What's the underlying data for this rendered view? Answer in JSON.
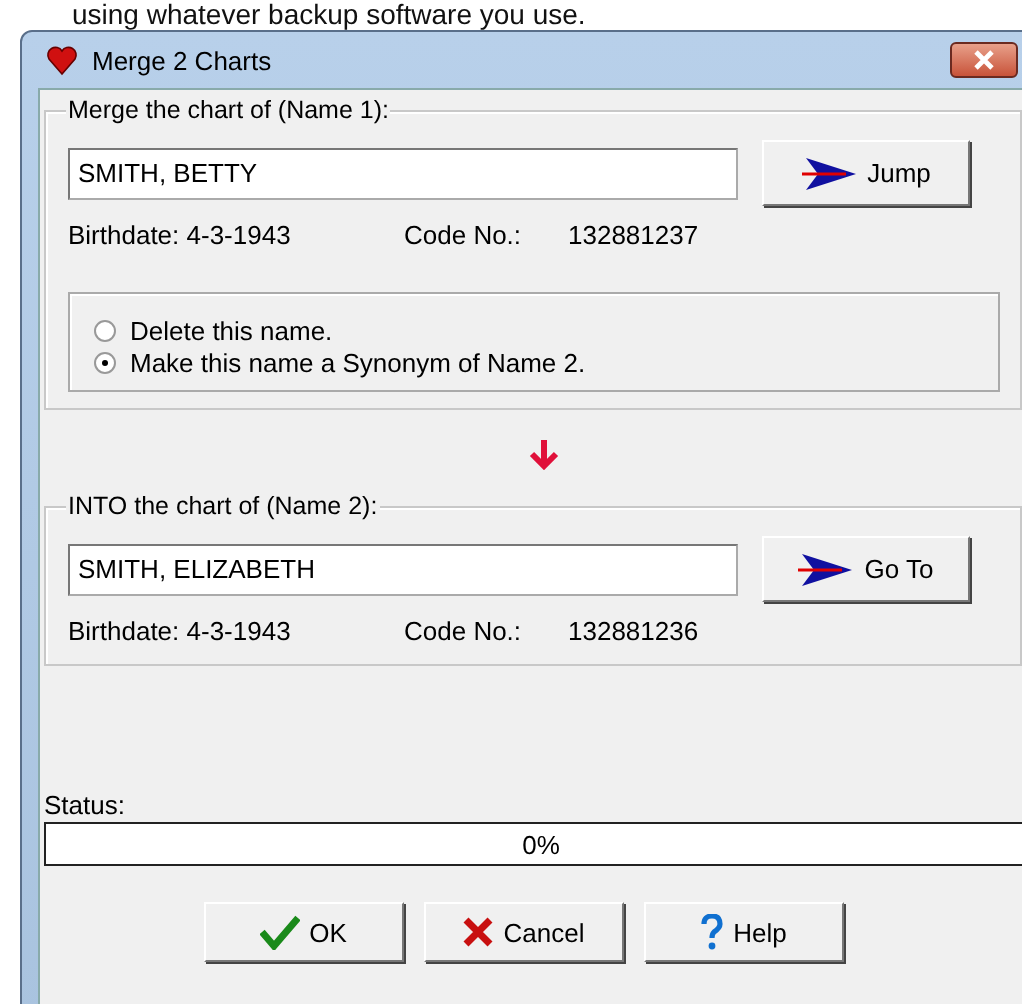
{
  "caption": "using whatever backup software you use.",
  "window": {
    "title": "Merge 2 Charts"
  },
  "groups": [
    {
      "legend": "Merge the chart of (Name 1):",
      "name": "SMITH, BETTY",
      "button": "Jump",
      "birthdate": "Birthdate: 4-3-1943",
      "code_label": "Code No.:",
      "code": "132881237",
      "options": [
        {
          "label": "Delete this name.",
          "selected": false
        },
        {
          "label": "Make this name a Synonym of Name 2.",
          "selected": true
        }
      ]
    },
    {
      "legend": "INTO the chart of (Name 2):",
      "name": "SMITH, ELIZABETH",
      "button": "Go To",
      "birthdate": "Birthdate: 4-3-1943",
      "code_label": "Code No.:",
      "code": "132881236"
    }
  ],
  "status": {
    "label": "Status:",
    "level": 0,
    "reading": "0%"
  },
  "buttons": [
    {
      "kind": "ok",
      "label": "OK"
    },
    {
      "kind": "cancel",
      "label": "Cancel"
    },
    {
      "kind": "help",
      "label": "Help"
    }
  ]
}
